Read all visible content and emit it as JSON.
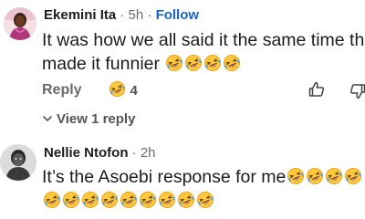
{
  "comments": [
    {
      "author": "Ekemini Ita",
      "time": " · 5h · ",
      "follow_label": "Follow",
      "text_line1": "It was how we all said it the same time that",
      "text_line2": "made it funnier",
      "reply_label": "Reply",
      "reaction_count": "4",
      "view_replies_label": "View 1 reply"
    },
    {
      "author": "Nellie Ntofon",
      "time": " · 2h",
      "text_line1": "It’s the Asoebi response for me"
    }
  ],
  "icons": {
    "reaction": "laughing-emoji-icon",
    "like": "thumbs-up-icon",
    "dislike": "thumbs-down-icon",
    "expand": "chevron-down-icon",
    "text_emoji": "rolling-on-floor-laughing-emoji"
  },
  "colors": {
    "follow": "#1a62c8",
    "muted": "#6b6b6b",
    "emoji_face": "#ffc83a"
  }
}
